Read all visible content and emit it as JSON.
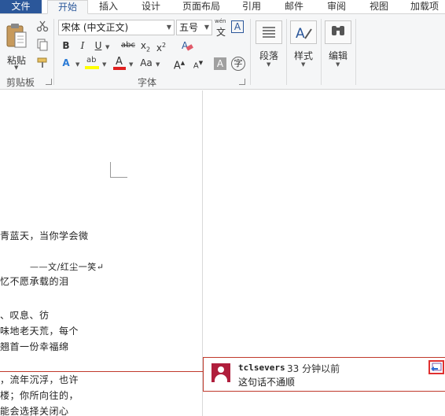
{
  "tabs": {
    "file": "文件",
    "home": "开始",
    "insert": "插入",
    "design": "设计",
    "layout": "页面布局",
    "references": "引用",
    "mailings": "邮件",
    "review": "审阅",
    "view": "视图",
    "addins": "加载项"
  },
  "clipboard": {
    "paste_label": "粘贴",
    "group_label": "剪贴板"
  },
  "font": {
    "family_value": "宋体 (中文正文)",
    "size_value": "五号",
    "wen_label": "wén",
    "wen_char": "文",
    "grow_label": "A",
    "shrink_label": "A",
    "case_label": "Aa",
    "group_label": "字体"
  },
  "paragraph": {
    "label": "段落"
  },
  "styles": {
    "label": "样式"
  },
  "editing": {
    "label": "编辑"
  },
  "document": {
    "lines": [
      "青蓝天，当你学会微",
      "——文/红尘一笑↵",
      "忆不愿承载的泪",
      "、叹息、彷",
      "味地老天荒，每个",
      "翘首一份幸福绵",
      "，流年沉浮，也许",
      "楼；你所向往的，",
      "能会选择关闭心"
    ]
  },
  "comment": {
    "author": "tclsevers",
    "time": "33 分钟以前",
    "text": "这句话不通顺"
  },
  "colors": {
    "accent": "#2b579a",
    "comment_border": "#c0392b",
    "avatar": "#b01e3c",
    "highlight": "#ffff00",
    "font_color": "#e02020"
  }
}
